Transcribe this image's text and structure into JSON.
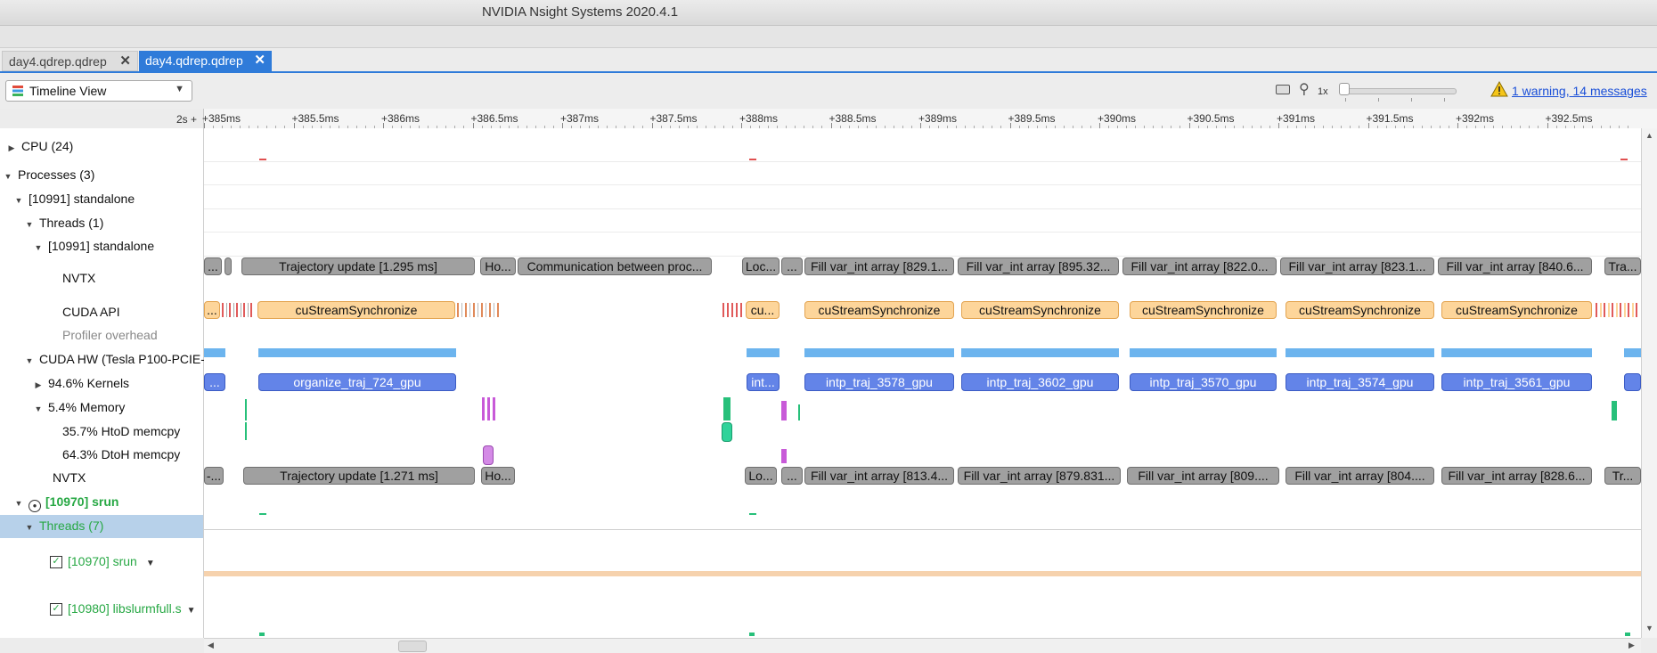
{
  "window": {
    "title": "NVIDIA Nsight Systems 2020.4.1"
  },
  "tabs": [
    {
      "label": "day4.qdrep.qdrep",
      "active": false
    },
    {
      "label": "day4.qdrep.qdrep",
      "active": true
    }
  ],
  "toolbar": {
    "view_selector": "Timeline View",
    "zoom_label": "1x",
    "warnings_link": "1 warning, 14 messages"
  },
  "ruler": {
    "unit": "2s +",
    "ticks": [
      "+385ms",
      "+385.5ms",
      "+386ms",
      "+386.5ms",
      "+387ms",
      "+387.5ms",
      "+388ms",
      "+388.5ms",
      "+389ms",
      "+389.5ms",
      "+390ms",
      "+390.5ms",
      "+391ms",
      "+391.5ms",
      "+392ms",
      "+392.5ms"
    ]
  },
  "tree": {
    "cpu": "CPU (24)",
    "processes": "Processes (3)",
    "proc1": "[10991] standalone",
    "threads1": "Threads (1)",
    "thread1": "[10991] standalone",
    "nvtx": "NVTX",
    "cuda_api": "CUDA API",
    "profiler_overhead": "Profiler overhead",
    "cuda_hw": "CUDA HW (Tesla P100-PCIE-",
    "kernels": "94.6% Kernels",
    "memory": "5.4% Memory",
    "htod": "35.7% HtoD memcpy",
    "dtoh": "64.3% DtoH memcpy",
    "nvtx2": "NVTX",
    "proc2": "[10970] srun",
    "threads2": "Threads (7)",
    "thread_srun": "[10970] srun",
    "thread_lib": "[10980] libslurmfull.s"
  },
  "timeline": {
    "nvtx_row": [
      "...",
      "Trajectory update [1.295 ms]",
      "Ho...",
      "Communication between proc...",
      "Loc...",
      "...",
      "Fill var_int array [829.1...",
      "Fill var_int array [895.32...",
      "Fill var_int array [822.0...",
      "Fill var_int array [823.1...",
      "Fill var_int array [840.6...",
      "Tra..."
    ],
    "cuda_row": [
      "...",
      "cuStreamSynchronize",
      "cu...",
      "cuStreamSynchronize",
      "cuStreamSynchronize",
      "cuStreamSynchronize",
      "cuStreamSynchronize",
      "cuStreamSynchronize"
    ],
    "kernel_row": [
      "...",
      "organize_traj_724_gpu",
      "int...",
      "intp_traj_3578_gpu",
      "intp_traj_3602_gpu",
      "intp_traj_3570_gpu",
      "intp_traj_3574_gpu",
      "intp_traj_3561_gpu"
    ],
    "nvtx2_row": [
      "-...",
      "Trajectory update [1.271 ms]",
      "Ho...",
      "Lo...",
      "...",
      "Fill var_int array [813.4...",
      "Fill var_int array [879.831...",
      "Fill var_int array [809....",
      "Fill var_int array [804....",
      "Fill var_int array [828.6...",
      "Tr..."
    ]
  },
  "colors": {
    "nvtx": "#a0a0a0",
    "cuda_api": "#fdd59a",
    "kernel": "#6384e8",
    "hw_usage": "#6cb4ee",
    "accent_tab": "#2f7bd9",
    "link": "#1a4fd8"
  }
}
